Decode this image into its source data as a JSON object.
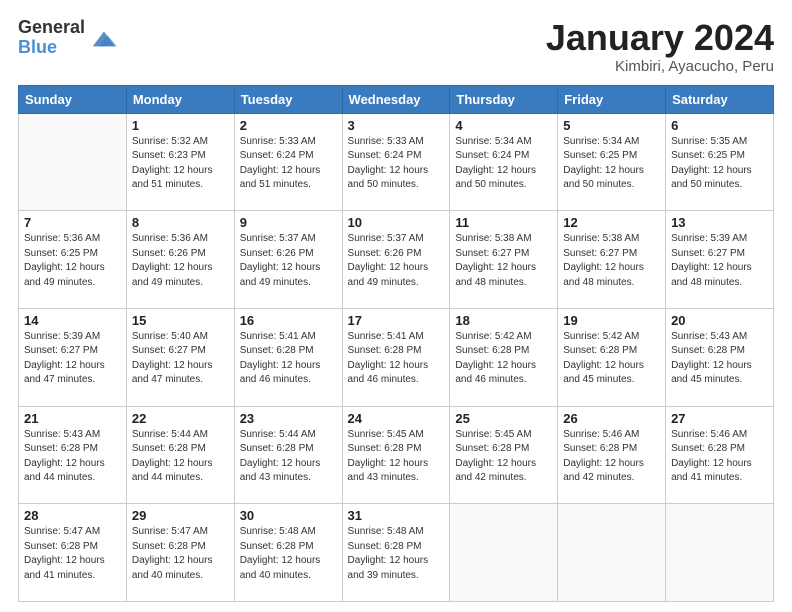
{
  "header": {
    "logo": {
      "line1": "General",
      "line2": "Blue"
    },
    "title": "January 2024",
    "location": "Kimbiri, Ayacucho, Peru"
  },
  "days_of_week": [
    "Sunday",
    "Monday",
    "Tuesday",
    "Wednesday",
    "Thursday",
    "Friday",
    "Saturday"
  ],
  "weeks": [
    [
      {
        "day": "",
        "info": ""
      },
      {
        "day": "1",
        "info": "Sunrise: 5:32 AM\nSunset: 6:23 PM\nDaylight: 12 hours\nand 51 minutes."
      },
      {
        "day": "2",
        "info": "Sunrise: 5:33 AM\nSunset: 6:24 PM\nDaylight: 12 hours\nand 51 minutes."
      },
      {
        "day": "3",
        "info": "Sunrise: 5:33 AM\nSunset: 6:24 PM\nDaylight: 12 hours\nand 50 minutes."
      },
      {
        "day": "4",
        "info": "Sunrise: 5:34 AM\nSunset: 6:24 PM\nDaylight: 12 hours\nand 50 minutes."
      },
      {
        "day": "5",
        "info": "Sunrise: 5:34 AM\nSunset: 6:25 PM\nDaylight: 12 hours\nand 50 minutes."
      },
      {
        "day": "6",
        "info": "Sunrise: 5:35 AM\nSunset: 6:25 PM\nDaylight: 12 hours\nand 50 minutes."
      }
    ],
    [
      {
        "day": "7",
        "info": "Sunrise: 5:36 AM\nSunset: 6:25 PM\nDaylight: 12 hours\nand 49 minutes."
      },
      {
        "day": "8",
        "info": "Sunrise: 5:36 AM\nSunset: 6:26 PM\nDaylight: 12 hours\nand 49 minutes."
      },
      {
        "day": "9",
        "info": "Sunrise: 5:37 AM\nSunset: 6:26 PM\nDaylight: 12 hours\nand 49 minutes."
      },
      {
        "day": "10",
        "info": "Sunrise: 5:37 AM\nSunset: 6:26 PM\nDaylight: 12 hours\nand 49 minutes."
      },
      {
        "day": "11",
        "info": "Sunrise: 5:38 AM\nSunset: 6:27 PM\nDaylight: 12 hours\nand 48 minutes."
      },
      {
        "day": "12",
        "info": "Sunrise: 5:38 AM\nSunset: 6:27 PM\nDaylight: 12 hours\nand 48 minutes."
      },
      {
        "day": "13",
        "info": "Sunrise: 5:39 AM\nSunset: 6:27 PM\nDaylight: 12 hours\nand 48 minutes."
      }
    ],
    [
      {
        "day": "14",
        "info": "Sunrise: 5:39 AM\nSunset: 6:27 PM\nDaylight: 12 hours\nand 47 minutes."
      },
      {
        "day": "15",
        "info": "Sunrise: 5:40 AM\nSunset: 6:27 PM\nDaylight: 12 hours\nand 47 minutes."
      },
      {
        "day": "16",
        "info": "Sunrise: 5:41 AM\nSunset: 6:28 PM\nDaylight: 12 hours\nand 46 minutes."
      },
      {
        "day": "17",
        "info": "Sunrise: 5:41 AM\nSunset: 6:28 PM\nDaylight: 12 hours\nand 46 minutes."
      },
      {
        "day": "18",
        "info": "Sunrise: 5:42 AM\nSunset: 6:28 PM\nDaylight: 12 hours\nand 46 minutes."
      },
      {
        "day": "19",
        "info": "Sunrise: 5:42 AM\nSunset: 6:28 PM\nDaylight: 12 hours\nand 45 minutes."
      },
      {
        "day": "20",
        "info": "Sunrise: 5:43 AM\nSunset: 6:28 PM\nDaylight: 12 hours\nand 45 minutes."
      }
    ],
    [
      {
        "day": "21",
        "info": "Sunrise: 5:43 AM\nSunset: 6:28 PM\nDaylight: 12 hours\nand 44 minutes."
      },
      {
        "day": "22",
        "info": "Sunrise: 5:44 AM\nSunset: 6:28 PM\nDaylight: 12 hours\nand 44 minutes."
      },
      {
        "day": "23",
        "info": "Sunrise: 5:44 AM\nSunset: 6:28 PM\nDaylight: 12 hours\nand 43 minutes."
      },
      {
        "day": "24",
        "info": "Sunrise: 5:45 AM\nSunset: 6:28 PM\nDaylight: 12 hours\nand 43 minutes."
      },
      {
        "day": "25",
        "info": "Sunrise: 5:45 AM\nSunset: 6:28 PM\nDaylight: 12 hours\nand 42 minutes."
      },
      {
        "day": "26",
        "info": "Sunrise: 5:46 AM\nSunset: 6:28 PM\nDaylight: 12 hours\nand 42 minutes."
      },
      {
        "day": "27",
        "info": "Sunrise: 5:46 AM\nSunset: 6:28 PM\nDaylight: 12 hours\nand 41 minutes."
      }
    ],
    [
      {
        "day": "28",
        "info": "Sunrise: 5:47 AM\nSunset: 6:28 PM\nDaylight: 12 hours\nand 41 minutes."
      },
      {
        "day": "29",
        "info": "Sunrise: 5:47 AM\nSunset: 6:28 PM\nDaylight: 12 hours\nand 40 minutes."
      },
      {
        "day": "30",
        "info": "Sunrise: 5:48 AM\nSunset: 6:28 PM\nDaylight: 12 hours\nand 40 minutes."
      },
      {
        "day": "31",
        "info": "Sunrise: 5:48 AM\nSunset: 6:28 PM\nDaylight: 12 hours\nand 39 minutes."
      },
      {
        "day": "",
        "info": ""
      },
      {
        "day": "",
        "info": ""
      },
      {
        "day": "",
        "info": ""
      }
    ]
  ]
}
